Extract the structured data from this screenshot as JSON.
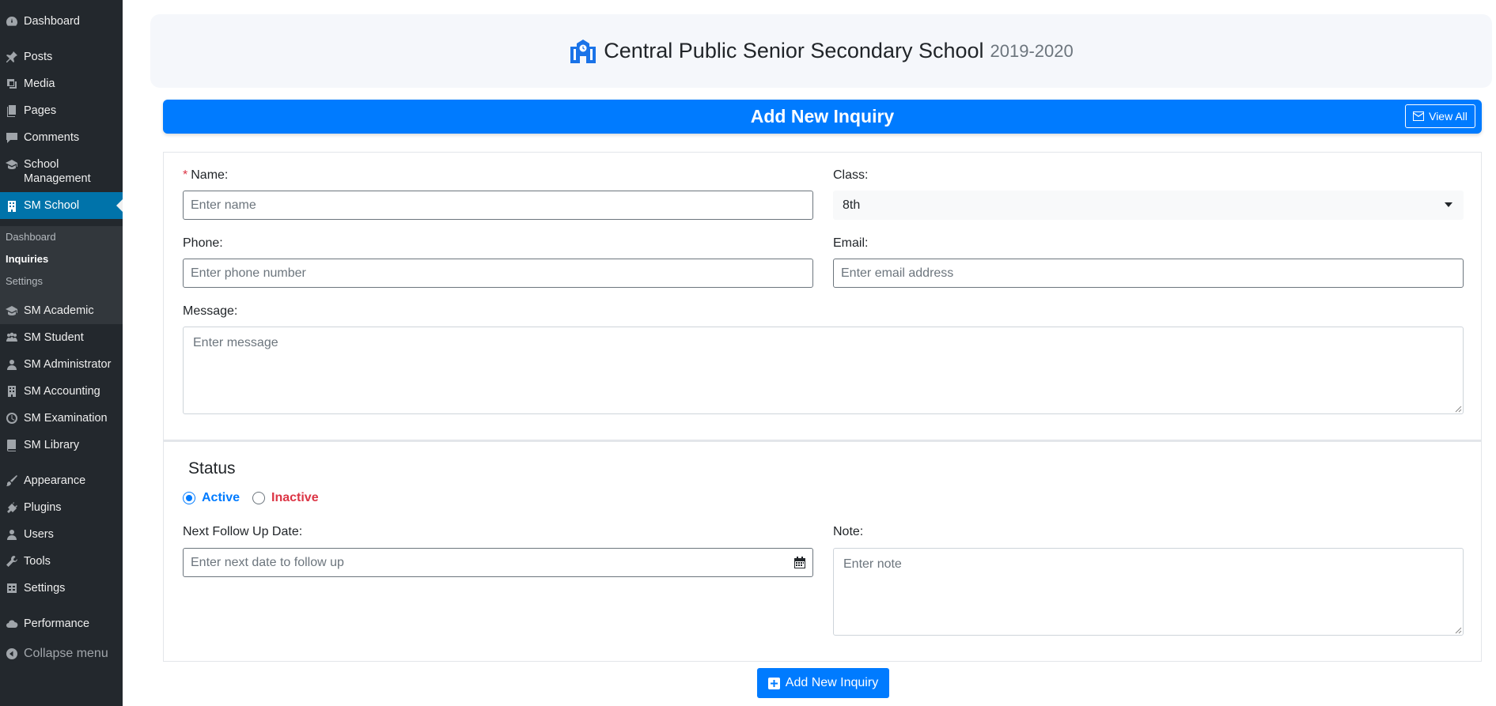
{
  "sidebar": {
    "items": [
      {
        "label": "Dashboard",
        "icon": "dashboard-icon"
      },
      {
        "label": "Posts",
        "icon": "pin-icon"
      },
      {
        "label": "Media",
        "icon": "media-icon"
      },
      {
        "label": "Pages",
        "icon": "pages-icon"
      },
      {
        "label": "Comments",
        "icon": "comment-icon"
      },
      {
        "label": "School Management",
        "icon": "graduation-cap-icon"
      },
      {
        "label": "SM School",
        "icon": "building-icon"
      },
      {
        "label": "SM Academic",
        "icon": "graduation-cap-icon"
      },
      {
        "label": "SM Student",
        "icon": "groups-icon"
      },
      {
        "label": "SM Administrator",
        "icon": "user-icon"
      },
      {
        "label": "SM Accounting",
        "icon": "building-icon"
      },
      {
        "label": "SM Examination",
        "icon": "clock-icon"
      },
      {
        "label": "SM Library",
        "icon": "book-icon"
      },
      {
        "label": "Appearance",
        "icon": "brush-icon"
      },
      {
        "label": "Plugins",
        "icon": "plugin-icon"
      },
      {
        "label": "Users",
        "icon": "users-icon"
      },
      {
        "label": "Tools",
        "icon": "wrench-icon"
      },
      {
        "label": "Settings",
        "icon": "settings-icon"
      },
      {
        "label": "Performance",
        "icon": "cloud-icon"
      }
    ],
    "submenu": [
      "Dashboard",
      "Inquiries",
      "Settings"
    ],
    "collapse_label": "Collapse menu"
  },
  "header": {
    "school_name": "Central Public Senior Secondary School",
    "session": "2019-2020"
  },
  "form": {
    "title": "Add New Inquiry",
    "view_all_label": "View All",
    "name_label": "Name:",
    "name_required_mark": "*",
    "name_placeholder": "Enter name",
    "class_label": "Class:",
    "class_value": "8th",
    "phone_label": "Phone:",
    "phone_placeholder": "Enter phone number",
    "email_label": "Email:",
    "email_placeholder": "Enter email address",
    "message_label": "Message:",
    "message_placeholder": "Enter message",
    "status_title": "Status",
    "status_active": "Active",
    "status_inactive": "Inactive",
    "status_selected": "Active",
    "follow_label": "Next Follow Up Date:",
    "follow_placeholder": "Enter next date to follow up",
    "note_label": "Note:",
    "note_placeholder": "Enter note",
    "submit_label": "Add New Inquiry"
  },
  "colors": {
    "primary": "#007bff",
    "sidebar_bg": "#23282d",
    "sidebar_active": "#0073aa",
    "danger": "#dc3545"
  }
}
